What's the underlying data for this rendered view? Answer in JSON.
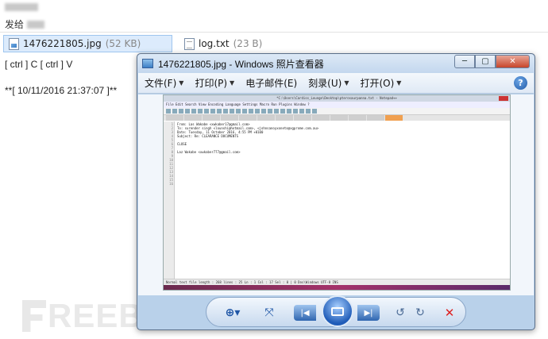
{
  "email": {
    "to_label": "发给",
    "attachments": [
      {
        "name": "1476221805.jpg",
        "size": "(52 KB)"
      },
      {
        "name": "log.txt",
        "size": "(23 B)"
      }
    ],
    "body_lines": [
      "[ ctrl ] C [ ctrl ] V",
      "**[ 10/11/2016 21:37:07 ]**"
    ],
    "watermark": "REEBUF"
  },
  "viewer": {
    "title": "1476221805.jpg - Windows 照片查看器",
    "buttons": {
      "minimize": "─",
      "maximize": "▢",
      "close": "✕"
    },
    "menus": [
      {
        "label": "文件(F)"
      },
      {
        "label": "打印(P)"
      },
      {
        "label": "电子邮件(E)"
      },
      {
        "label": "刻录(U)"
      },
      {
        "label": "打开(O)"
      }
    ],
    "help": "?"
  },
  "notepad": {
    "title": "*C:\\Users\\Cardiss_Lounge\\Desktop\\pterosaurpanna.txt - Notepad++",
    "menu": "File  Edit  Search  View  Encoding  Language  Settings  Macro  Run  Plugins  Window  ?",
    "gutter": "1\n2\n3\n4\n5\n6\n7\n8\n9\n10\n11\n12\n13\n14\n15\n16",
    "lines": "From: Las Wakabe <xwkaber17@gmail.com>\nTo: surender singh <lounshi@hotmail.com>, <johnsanoyxoneto@xgprome.com.au>\nDate: Tuesday, 11 October 2016, 4:55 PM +0100\nSubject: Re: CLEARANCE DOCUMENTS\n\nCLOSE\n\nLaz Wakabe <xwkaber777@gmail.com>",
    "status": "Normal text file           length : 268   lines : 25         Ln : 1   Col : 17   Sel : 0 | 0           Dos\\Windows         UTF-8          INS"
  }
}
